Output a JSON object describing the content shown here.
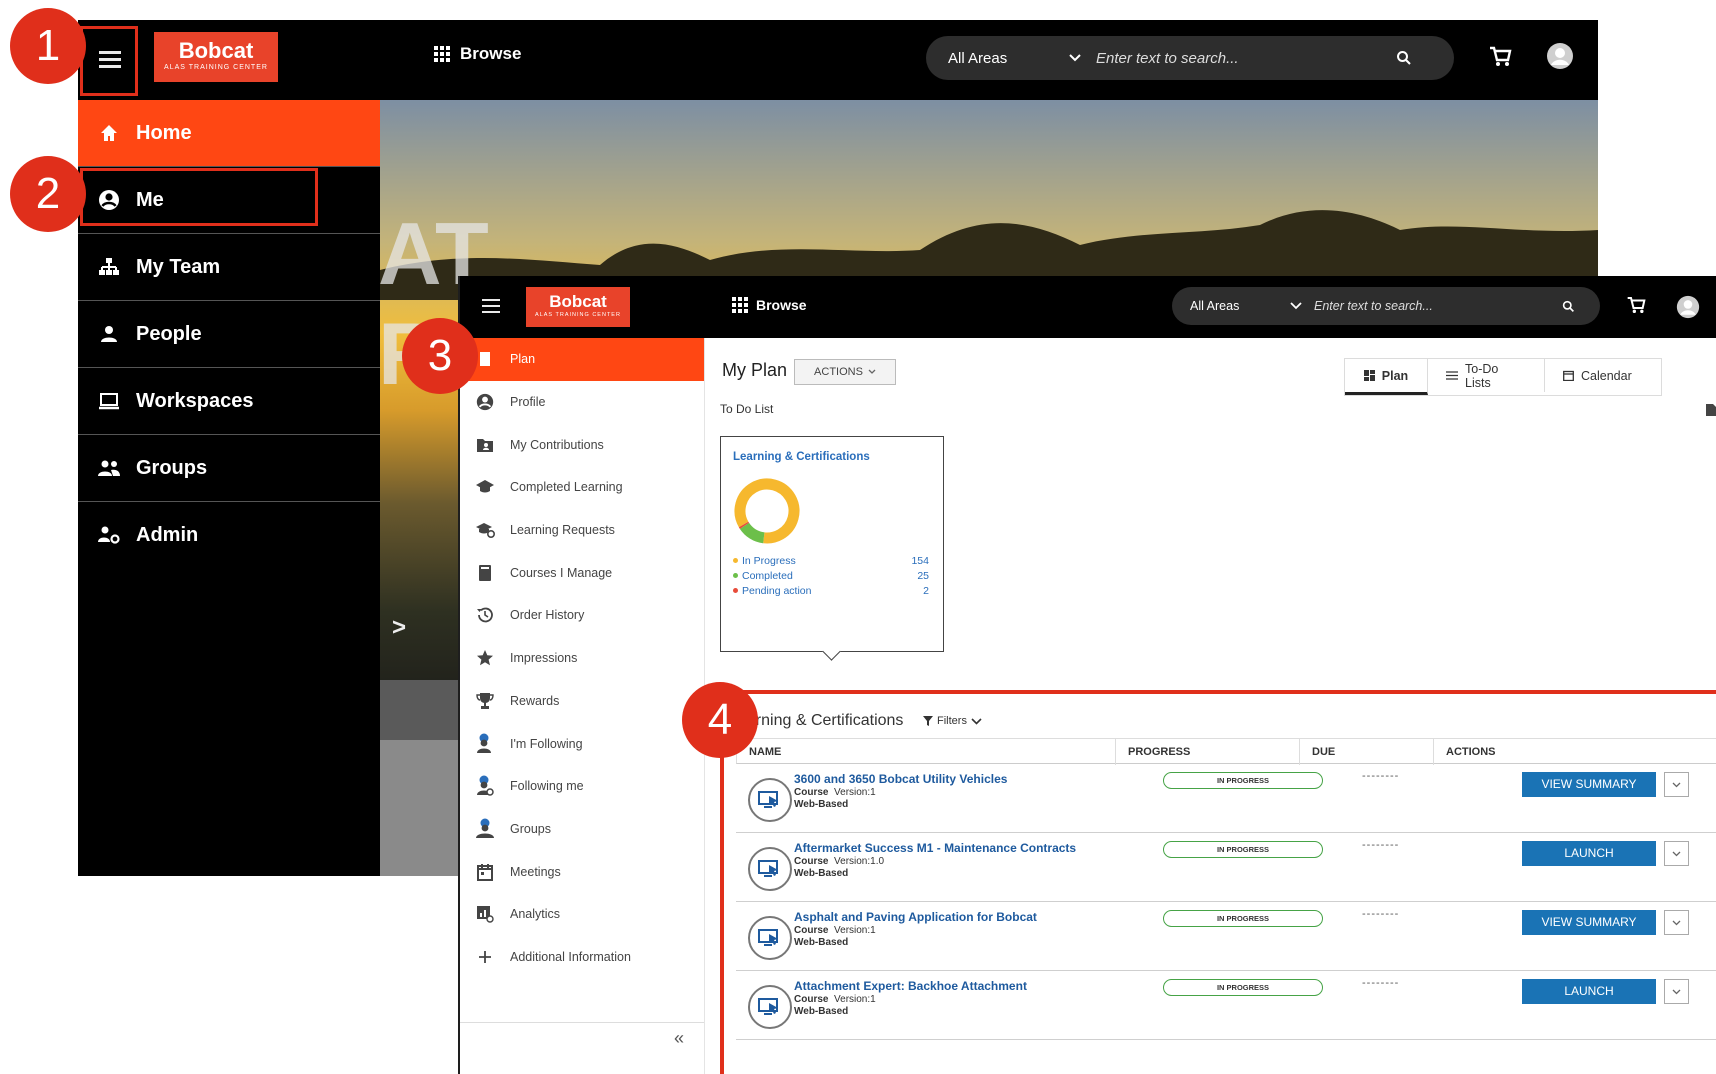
{
  "back": {
    "logo": {
      "name": "Bobcat",
      "tagline": "ALAS TRAINING CENTER"
    },
    "browse_label": "Browse",
    "search": {
      "area": "All Areas",
      "placeholder": "Enter text to search..."
    },
    "hero_text": [
      "AT",
      "R"
    ],
    "hero_chevron": ">",
    "menu": [
      {
        "label": "Home",
        "icon": "home-icon",
        "active": true
      },
      {
        "label": "Me",
        "icon": "account-circle-icon"
      },
      {
        "label": "My Team",
        "icon": "org-chart-icon"
      },
      {
        "label": "People",
        "icon": "person-icon"
      },
      {
        "label": "Workspaces",
        "icon": "laptop-icon"
      },
      {
        "label": "Groups",
        "icon": "group-icon"
      },
      {
        "label": "Admin",
        "icon": "admin-gear-icon"
      }
    ]
  },
  "front": {
    "logo": {
      "name": "Bobcat",
      "tagline": "ALAS TRAINING CENTER"
    },
    "browse_label": "Browse",
    "search": {
      "area": "All Areas",
      "placeholder": "Enter text to search..."
    },
    "side": [
      {
        "label": "Plan",
        "icon": "plan-icon",
        "active": true
      },
      {
        "label": "Profile",
        "icon": "account-circle-icon"
      },
      {
        "label": "My Contributions",
        "icon": "folder-person-icon"
      },
      {
        "label": "Completed Learning",
        "icon": "graduation-cap-icon"
      },
      {
        "label": "Learning Requests",
        "icon": "graduation-request-icon"
      },
      {
        "label": "Courses I Manage",
        "icon": "book-icon"
      },
      {
        "label": "Order History",
        "icon": "history-icon"
      },
      {
        "label": "Impressions",
        "icon": "star-icon"
      },
      {
        "label": "Rewards",
        "icon": "trophy-icon"
      },
      {
        "label": "I'm Following",
        "icon": "following-icon"
      },
      {
        "label": "Following me",
        "icon": "followers-icon"
      },
      {
        "label": "Groups",
        "icon": "groups-icon"
      },
      {
        "label": "Meetings",
        "icon": "calendar-icon"
      },
      {
        "label": "Analytics",
        "icon": "analytics-icon"
      },
      {
        "label": "Additional Information",
        "icon": "plus-icon"
      }
    ],
    "collapse_label": "«",
    "main": {
      "title": "My Plan",
      "actions_label": "ACTIONS",
      "tabs": [
        {
          "label": "Plan",
          "icon": "dashboard-icon",
          "active": true
        },
        {
          "label": "To-Do Lists",
          "icon": "list-icon"
        },
        {
          "label": "Calendar",
          "icon": "calendar-icon"
        }
      ],
      "todo_label": "To Do List",
      "card": {
        "title": "Learning & Certifications",
        "legend": [
          {
            "label": "In Progress",
            "value": 154,
            "color": "#f6b82e"
          },
          {
            "label": "Completed",
            "value": 25,
            "color": "#6cbf4a"
          },
          {
            "label": "Pending action",
            "value": 2,
            "color": "#e84b3a"
          }
        ]
      },
      "section_title": "earning & Certifications",
      "filters_label": "Filters",
      "columns": [
        "NAME",
        "PROGRESS",
        "DUE",
        "ACTIONS"
      ],
      "rows": [
        {
          "title": "3600 and 3650 Bobcat Utility Vehicles",
          "type": "Course",
          "version": "Version:1",
          "delivery": "Web-Based",
          "progress": "IN PROGRESS",
          "due": "--------",
          "action": "VIEW SUMMARY"
        },
        {
          "title": "Aftermarket Success M1 - Maintenance Contracts",
          "type": "Course",
          "version": "Version:1.0",
          "delivery": "Web-Based",
          "progress": "IN PROGRESS",
          "due": "--------",
          "action": "LAUNCH"
        },
        {
          "title": "Asphalt and Paving Application for Bobcat",
          "type": "Course",
          "version": "Version:1",
          "delivery": "Web-Based",
          "progress": "IN PROGRESS",
          "due": "--------",
          "action": "VIEW SUMMARY"
        },
        {
          "title": "Attachment Expert: Backhoe Attachment",
          "type": "Course",
          "version": "Version:1",
          "delivery": "Web-Based",
          "progress": "IN PROGRESS",
          "due": "--------",
          "action": "LAUNCH"
        }
      ]
    }
  },
  "callouts": [
    "1",
    "2",
    "3",
    "4"
  ],
  "colors": {
    "accent": "#ff4713",
    "callout": "#e02f1b",
    "link": "#1e5a9e",
    "button": "#1a73b5"
  }
}
